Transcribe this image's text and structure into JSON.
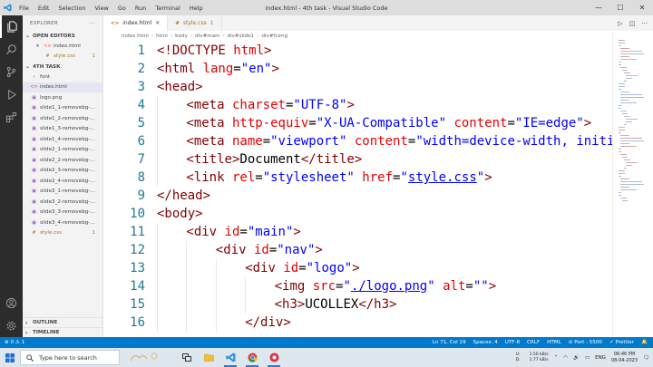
{
  "window": {
    "title": "index.html - 4th task - Visual Studio Code",
    "menu": [
      "File",
      "Edit",
      "Selection",
      "View",
      "Go",
      "Run",
      "Terminal",
      "Help"
    ]
  },
  "sidebar": {
    "header": "EXPLORER",
    "open_editors_label": "OPEN EDITORS",
    "open_editors": [
      {
        "name": "index.html",
        "type": "html",
        "badge": ""
      },
      {
        "name": "style.css",
        "type": "css",
        "badge": "1"
      }
    ],
    "folder_label": "4TH TASK",
    "files": [
      {
        "name": "font",
        "type": "folder",
        "badge": ""
      },
      {
        "name": "index.html",
        "type": "html",
        "badge": ""
      },
      {
        "name": "logo.png",
        "type": "img",
        "badge": ""
      },
      {
        "name": "slide1_1-removebg-p...",
        "type": "img",
        "badge": ""
      },
      {
        "name": "slide1_2-removebg-p...",
        "type": "img",
        "badge": ""
      },
      {
        "name": "slide1_3-removebg-p...",
        "type": "img",
        "badge": ""
      },
      {
        "name": "slide1_4-removebg-p...",
        "type": "img",
        "badge": ""
      },
      {
        "name": "slide2_1-removebg-p...",
        "type": "img",
        "badge": ""
      },
      {
        "name": "slide2_2-removebg-p...",
        "type": "img",
        "badge": ""
      },
      {
        "name": "slide2_3-removebg-p...",
        "type": "img",
        "badge": ""
      },
      {
        "name": "slide2_4-removebg-p...",
        "type": "img",
        "badge": ""
      },
      {
        "name": "slide3_1-removebg-p...",
        "type": "img",
        "badge": ""
      },
      {
        "name": "slide3_2-removebg-p...",
        "type": "img",
        "badge": ""
      },
      {
        "name": "slide3_3-removebg-p...",
        "type": "img",
        "badge": ""
      },
      {
        "name": "slide3_4-removebg-p...",
        "type": "img",
        "badge": ""
      },
      {
        "name": "style.css",
        "type": "css",
        "badge": "1"
      }
    ],
    "outline_label": "OUTLINE",
    "timeline_label": "TIMELINE"
  },
  "tabs": [
    {
      "name": "index.html",
      "type": "html",
      "active": true,
      "badge": ""
    },
    {
      "name": "style.css",
      "type": "css",
      "active": false,
      "badge": "1"
    }
  ],
  "breadcrumb": [
    "index.html",
    "html",
    "body",
    "div#main",
    "div#slide1",
    "div#fcimg"
  ],
  "editor": {
    "lines": [
      {
        "n": "1",
        "indent": 0,
        "tokens": [
          [
            "tag",
            "<!DOCTYPE "
          ],
          [
            "attr",
            "html"
          ],
          [
            "tag",
            ">"
          ]
        ]
      },
      {
        "n": "2",
        "indent": 0,
        "tokens": [
          [
            "tag",
            "<html "
          ],
          [
            "attr",
            "lang"
          ],
          [
            "txt",
            "="
          ],
          [
            "str",
            "\"en\""
          ],
          [
            "tag",
            ">"
          ]
        ]
      },
      {
        "n": "3",
        "indent": 0,
        "tokens": [
          [
            "tag",
            "<head>"
          ]
        ]
      },
      {
        "n": "4",
        "indent": 1,
        "tokens": [
          [
            "tag",
            "<meta "
          ],
          [
            "attr",
            "charset"
          ],
          [
            "txt",
            "="
          ],
          [
            "str",
            "\"UTF-8\""
          ],
          [
            "tag",
            ">"
          ]
        ]
      },
      {
        "n": "5",
        "indent": 1,
        "tokens": [
          [
            "tag",
            "<meta "
          ],
          [
            "attr",
            "http-equiv"
          ],
          [
            "txt",
            "="
          ],
          [
            "str",
            "\"X-UA-Compatible\""
          ],
          [
            "txt",
            " "
          ],
          [
            "attr",
            "content"
          ],
          [
            "txt",
            "="
          ],
          [
            "str",
            "\"IE=edge\""
          ],
          [
            "tag",
            ">"
          ]
        ]
      },
      {
        "n": "6",
        "indent": 1,
        "tokens": [
          [
            "tag",
            "<meta "
          ],
          [
            "attr",
            "name"
          ],
          [
            "txt",
            "="
          ],
          [
            "str",
            "\"viewport\""
          ],
          [
            "txt",
            " "
          ],
          [
            "attr",
            "content"
          ],
          [
            "txt",
            "="
          ],
          [
            "str",
            "\"width=device-width, initial"
          ]
        ]
      },
      {
        "n": "7",
        "indent": 1,
        "tokens": [
          [
            "tag",
            "<title>"
          ],
          [
            "txt",
            "Document"
          ],
          [
            "tag",
            "</title>"
          ]
        ]
      },
      {
        "n": "8",
        "indent": 1,
        "tokens": [
          [
            "tag",
            "<link "
          ],
          [
            "attr",
            "rel"
          ],
          [
            "txt",
            "="
          ],
          [
            "str",
            "\"stylesheet\""
          ],
          [
            "txt",
            " "
          ],
          [
            "attr",
            "href"
          ],
          [
            "txt",
            "="
          ],
          [
            "str",
            "\""
          ],
          [
            "link",
            "style.css"
          ],
          [
            "str",
            "\""
          ],
          [
            "tag",
            ">"
          ]
        ]
      },
      {
        "n": "9",
        "indent": 0,
        "tokens": [
          [
            "tag",
            "</head>"
          ]
        ]
      },
      {
        "n": "10",
        "indent": 0,
        "tokens": [
          [
            "tag",
            "<body>"
          ]
        ]
      },
      {
        "n": "11",
        "indent": 1,
        "tokens": [
          [
            "tag",
            "<div "
          ],
          [
            "attr",
            "id"
          ],
          [
            "txt",
            "="
          ],
          [
            "str",
            "\"main\""
          ],
          [
            "tag",
            ">"
          ]
        ]
      },
      {
        "n": "12",
        "indent": 2,
        "tokens": [
          [
            "tag",
            "<div "
          ],
          [
            "attr",
            "id"
          ],
          [
            "txt",
            "="
          ],
          [
            "str",
            "\"nav\""
          ],
          [
            "tag",
            ">"
          ]
        ]
      },
      {
        "n": "13",
        "indent": 3,
        "tokens": [
          [
            "tag",
            "<div "
          ],
          [
            "attr",
            "id"
          ],
          [
            "txt",
            "="
          ],
          [
            "str",
            "\"logo\""
          ],
          [
            "tag",
            ">"
          ]
        ]
      },
      {
        "n": "14",
        "indent": 4,
        "tokens": [
          [
            "tag",
            "<img "
          ],
          [
            "attr",
            "src"
          ],
          [
            "txt",
            "="
          ],
          [
            "str",
            "\""
          ],
          [
            "link",
            "./logo.png"
          ],
          [
            "str",
            "\""
          ],
          [
            "txt",
            " "
          ],
          [
            "attr",
            "alt"
          ],
          [
            "txt",
            "="
          ],
          [
            "str",
            "\"\""
          ],
          [
            "tag",
            ">"
          ]
        ]
      },
      {
        "n": "15",
        "indent": 4,
        "tokens": [
          [
            "tag",
            "<h3>"
          ],
          [
            "txt",
            "UCOLLEX"
          ],
          [
            "tag",
            "</h3>"
          ]
        ]
      },
      {
        "n": "16",
        "indent": 3,
        "tokens": [
          [
            "tag",
            "</div>"
          ]
        ]
      }
    ]
  },
  "statusbar": {
    "problems": "⊗ 0 ⚠ 1",
    "position": "Ln 71, Col 19",
    "spaces": "Spaces: 4",
    "encoding": "UTF-8",
    "eol": "CRLF",
    "language": "HTML",
    "port": "⊘ Port : 5500",
    "prettier": "✓ Prettier"
  },
  "taskbar": {
    "search_placeholder": "Type here to search",
    "net_up": "1.50 kB/s",
    "net_down": "1.77 kB/s",
    "net_u": "U:",
    "net_d": "D:",
    "lang": "ENG",
    "time": "06:46 PM",
    "date": "08-04-2023"
  },
  "colors": {
    "statusbar": "#007acc",
    "activitybar": "#2c2c2c",
    "tag": "#800000",
    "attr": "#e50000",
    "string": "#0000ff",
    "line_number": "#237893"
  }
}
